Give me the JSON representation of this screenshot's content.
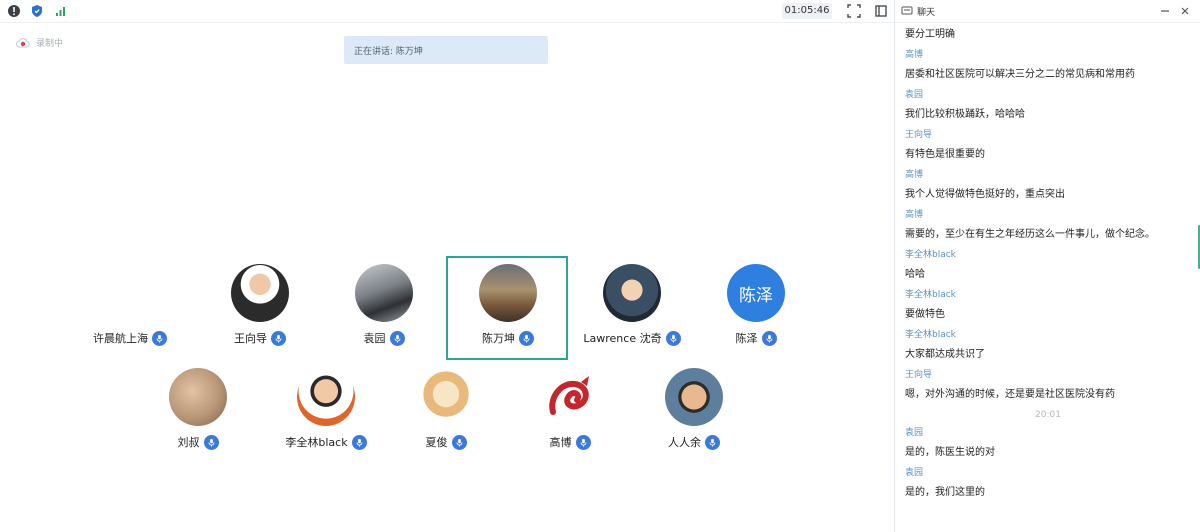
{
  "toolbar": {
    "timer": "01:05:46",
    "icons": [
      "info-icon",
      "shield-icon",
      "signal-icon",
      "fullscreen-icon",
      "window-icon"
    ]
  },
  "recording": {
    "label": "录制中"
  },
  "speaking": {
    "text": "正在讲话: 陈万坤"
  },
  "participants": [
    {
      "name": "许晨航上海",
      "avatar_color": ""
    },
    {
      "name": "王向导",
      "avatar_color": "#2b2b2b"
    },
    {
      "name": "袁园",
      "avatar_color": "#6e7378"
    },
    {
      "name": "陈万坤",
      "avatar_color": "#8a6a4c",
      "active": true
    },
    {
      "name": "Lawrence 沈奇",
      "avatar_color": "#3a4f63"
    },
    {
      "name": "陈泽",
      "avatar_color": "#2f7fe0",
      "avatar_text": "陈泽"
    },
    {
      "name": "刘叔",
      "avatar_color": "#b89577"
    },
    {
      "name": "李全林black",
      "avatar_color": "#e89a4a"
    },
    {
      "name": "夏俊",
      "avatar_color": "#f3dfb8"
    },
    {
      "name": "高博",
      "avatar_color": "#c4262e"
    },
    {
      "name": "人人余",
      "avatar_color": "#5d7e9c"
    }
  ],
  "chat": {
    "title": "聊天",
    "messages": [
      {
        "text": "要分工明确"
      },
      {
        "sender": "高博"
      },
      {
        "text": "居委和社区医院可以解决三分之二的常见病和常用药"
      },
      {
        "sender": "袁园"
      },
      {
        "text": "我们比较积极踊跃，哈哈哈"
      },
      {
        "sender": "王向导"
      },
      {
        "text": "有特色是很重要的"
      },
      {
        "sender": "高博"
      },
      {
        "text": "我个人觉得做特色挺好的，重点突出"
      },
      {
        "sender": "高博"
      },
      {
        "text": "需要的，至少在有生之年经历这么一件事儿，做个纪念。"
      },
      {
        "sender": "李全林black"
      },
      {
        "text": "哈哈"
      },
      {
        "sender": "李全林black"
      },
      {
        "text": "要做特色"
      },
      {
        "sender": "李全林black"
      },
      {
        "text": "大家都达成共识了"
      },
      {
        "sender": "王向导"
      },
      {
        "text": "嗯，对外沟通的时候，还是要是社区医院没有药"
      },
      {
        "time": "20:01"
      },
      {
        "sender": "袁园"
      },
      {
        "text": "是的，陈医生说的对"
      },
      {
        "sender": "袁园"
      },
      {
        "text": "是的，我们这里的"
      }
    ]
  }
}
